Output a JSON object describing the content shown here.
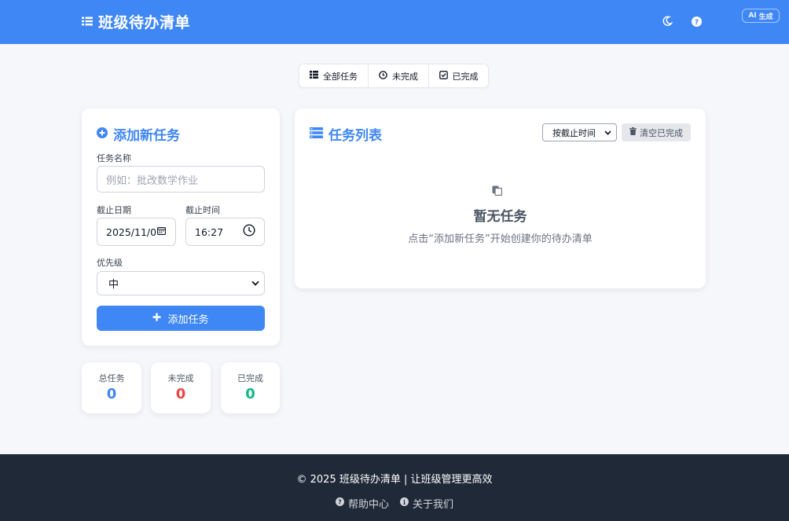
{
  "header": {
    "title": "班级待办清单",
    "ai_badge": "生成",
    "ai_badge_prefix": "AI",
    "icons": [
      "list-icon",
      "moon-icon",
      "question-icon"
    ]
  },
  "filters": [
    {
      "label": "全部任务",
      "icon": "list-icon"
    },
    {
      "label": "未完成",
      "icon": "clock-icon"
    },
    {
      "label": "已完成",
      "icon": "check-square-icon"
    }
  ],
  "add_form": {
    "title": "添加新任务",
    "name_label": "任务名称",
    "name_placeholder": "例如：批改数学作业",
    "date_label": "截止日期",
    "date_value": "2025/11/0",
    "time_label": "截止时间",
    "time_value": "16:27",
    "priority_label": "优先级",
    "priority_value": "中",
    "submit_label": "添加任务"
  },
  "stats": [
    {
      "label": "总任务",
      "value": "0",
      "color": "#3f87f5"
    },
    {
      "label": "未完成",
      "value": "0",
      "color": "#ef4444"
    },
    {
      "label": "已完成",
      "value": "0",
      "color": "#10b981"
    }
  ],
  "task_list": {
    "title": "任务列表",
    "sort_value": "按截止时间",
    "clear_label": "清空已完成",
    "empty_title": "暂无任务",
    "empty_subtitle": "点击“添加新任务”开始创建你的待办清单"
  },
  "footer": {
    "copyright": "© 2025 班级待办清单 | 让班级管理更高效",
    "links": [
      {
        "label": "帮助中心",
        "icon": "question-circle-icon"
      },
      {
        "label": "关于我们",
        "icon": "info-circle-icon"
      }
    ]
  },
  "colors": {
    "primary": "#3f87f5",
    "footer_bg": "#1f2937",
    "page_bg": "#f6f7fb"
  }
}
